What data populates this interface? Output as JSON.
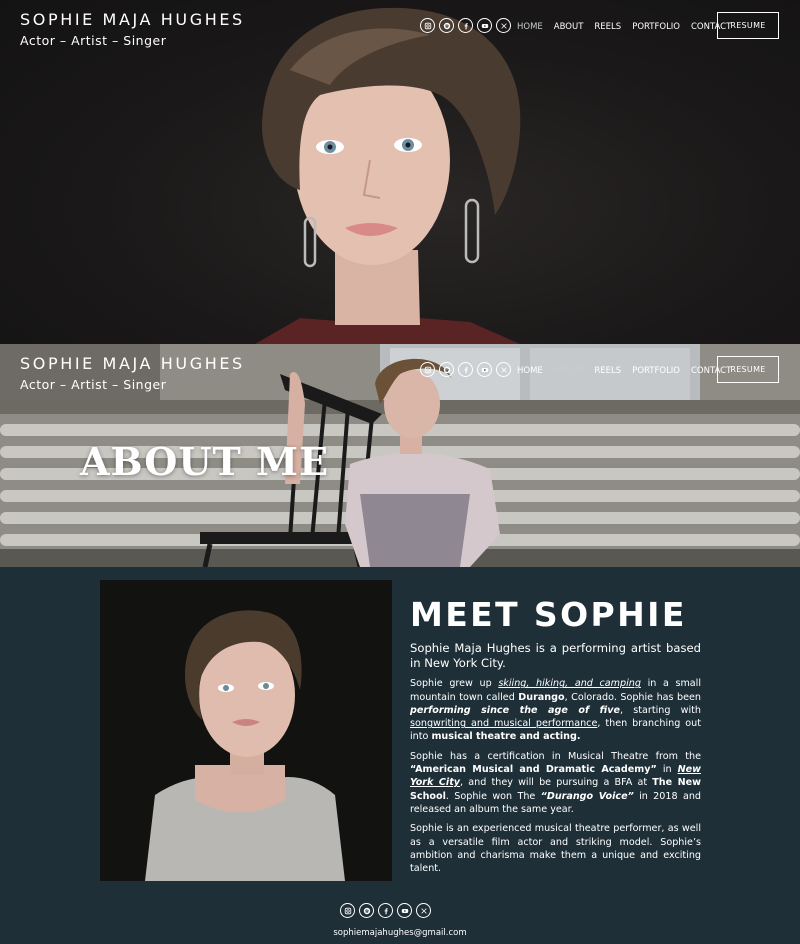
{
  "brand": {
    "name": "SOPHIE MAJA HUGHES",
    "tagline": "Actor – Artist – Singer"
  },
  "social_icons": [
    "instagram-icon",
    "spotify-icon",
    "facebook-icon",
    "youtube-icon",
    "x-icon"
  ],
  "nav": {
    "items": [
      {
        "label": "HOME"
      },
      {
        "label": "ABOUT"
      },
      {
        "label": "REELS"
      },
      {
        "label": "PORTFOLIO"
      },
      {
        "label": "CONTACT"
      }
    ],
    "resume_label": "RESUME"
  },
  "about_banner": {
    "title": "ABOUT ME"
  },
  "meet": {
    "heading": "MEET SOPHIE",
    "lead": "Sophie Maja Hughes is a performing artist based in New York City.",
    "p1": {
      "a": "Sophie grew up ",
      "b": "skiing, hiking, and camping",
      "c": " in a small mountain town called ",
      "d": "Durango",
      "e": ", Colorado. Sophie has been ",
      "f": "performing since the age of five",
      "g": ", starting with ",
      "h": "songwriting and musical performance",
      "i": ", then branching out into ",
      "j": "musical theatre and acting."
    },
    "p2": {
      "a": "Sophie has a certification in Musical Theatre from the ",
      "b": "“American Musical and Dramatic Academy”",
      "c": " in ",
      "d": "New York City",
      "e": ", and they will be pursuing a BFA at ",
      "f": "The New School",
      "g": ". Sophie won The ",
      "h": "“Durango Voice”",
      "i": " in 2018 and released an album the same year."
    },
    "p3": "Sophie is an experienced musical theatre performer, as well as a versatile film actor and striking model. Sophie’s ambition and charisma make them a unique and exciting talent."
  },
  "footer": {
    "email": "sophiemajahughes@gmail.com"
  },
  "colors": {
    "section_bg": "#1f2f38",
    "hero_bg": "#1a1818",
    "text": "#ffffff"
  }
}
